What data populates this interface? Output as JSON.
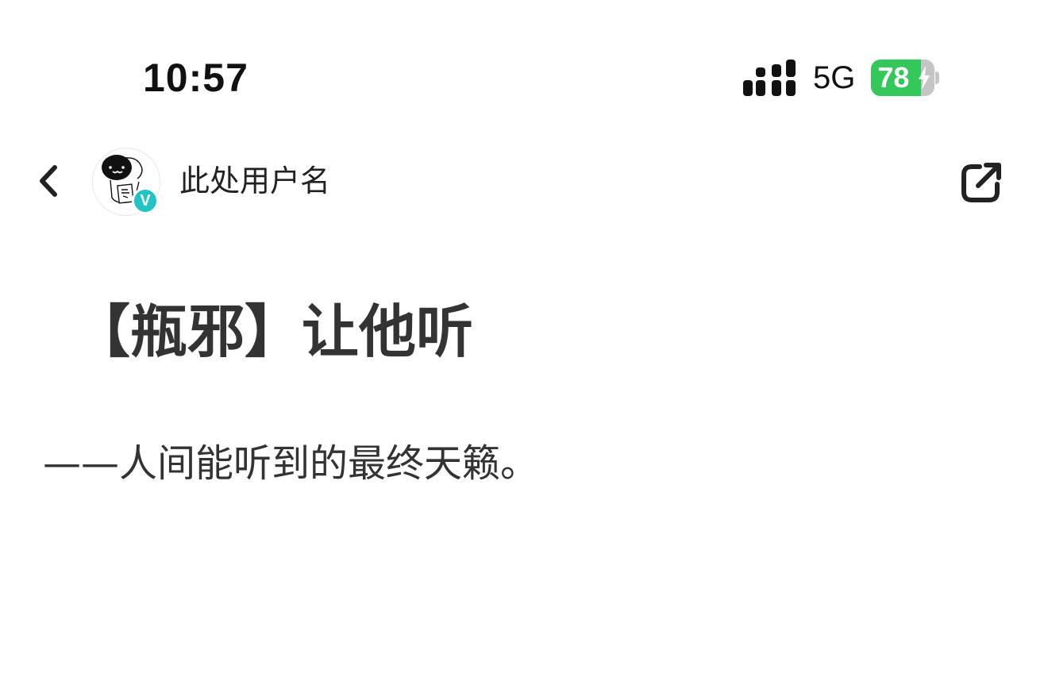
{
  "status_bar": {
    "time": "10:57",
    "network": "5G",
    "battery_level": "78",
    "battery_fraction": 0.78,
    "charging": true,
    "signal_icon": "signal-bars-icon",
    "battery_color": "#34c759"
  },
  "nav": {
    "back_icon": "chevron-left-icon",
    "username": "此处用户名",
    "verified_badge": "V",
    "share_icon": "share-external-icon"
  },
  "post": {
    "title": "【瓶邪】让他听",
    "subtitle": "——人间能听到的最终天籁。"
  },
  "colors": {
    "text": "#333333",
    "verified": "#22c3c5",
    "background": "#ffffff"
  }
}
